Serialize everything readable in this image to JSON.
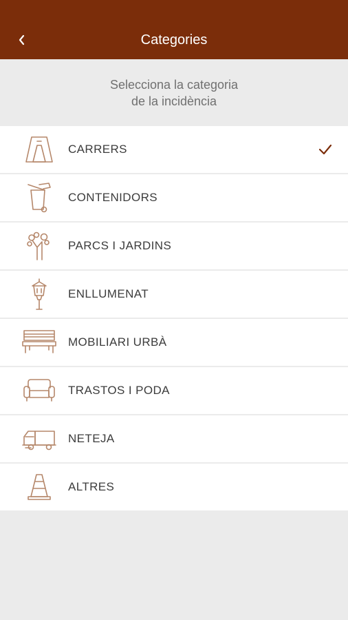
{
  "header": {
    "title": "Categories",
    "back_icon": "chevron-left-icon",
    "background_color": "#7b2d0a"
  },
  "subtitle": {
    "line1": "Selecciona la categoria",
    "line2": "de la incidència"
  },
  "categories": [
    {
      "label": "CARRERS",
      "icon": "road-icon",
      "selected": true
    },
    {
      "label": "CONTENIDORS",
      "icon": "container-icon",
      "selected": false
    },
    {
      "label": "PARCS I JARDINS",
      "icon": "tree-icon",
      "selected": false
    },
    {
      "label": "ENLLUMENAT",
      "icon": "streetlight-icon",
      "selected": false
    },
    {
      "label": "MOBILIARI URBÀ",
      "icon": "bench-icon",
      "selected": false
    },
    {
      "label": "TRASTOS I PODA",
      "icon": "sofa-icon",
      "selected": false
    },
    {
      "label": "NETEJA",
      "icon": "cleaning-truck-icon",
      "selected": false
    },
    {
      "label": "ALTRES",
      "icon": "traffic-cone-icon",
      "selected": false
    }
  ],
  "colors": {
    "accent": "#7b2d0a",
    "icon": "#b5876a",
    "check": "#7b2d0a"
  }
}
